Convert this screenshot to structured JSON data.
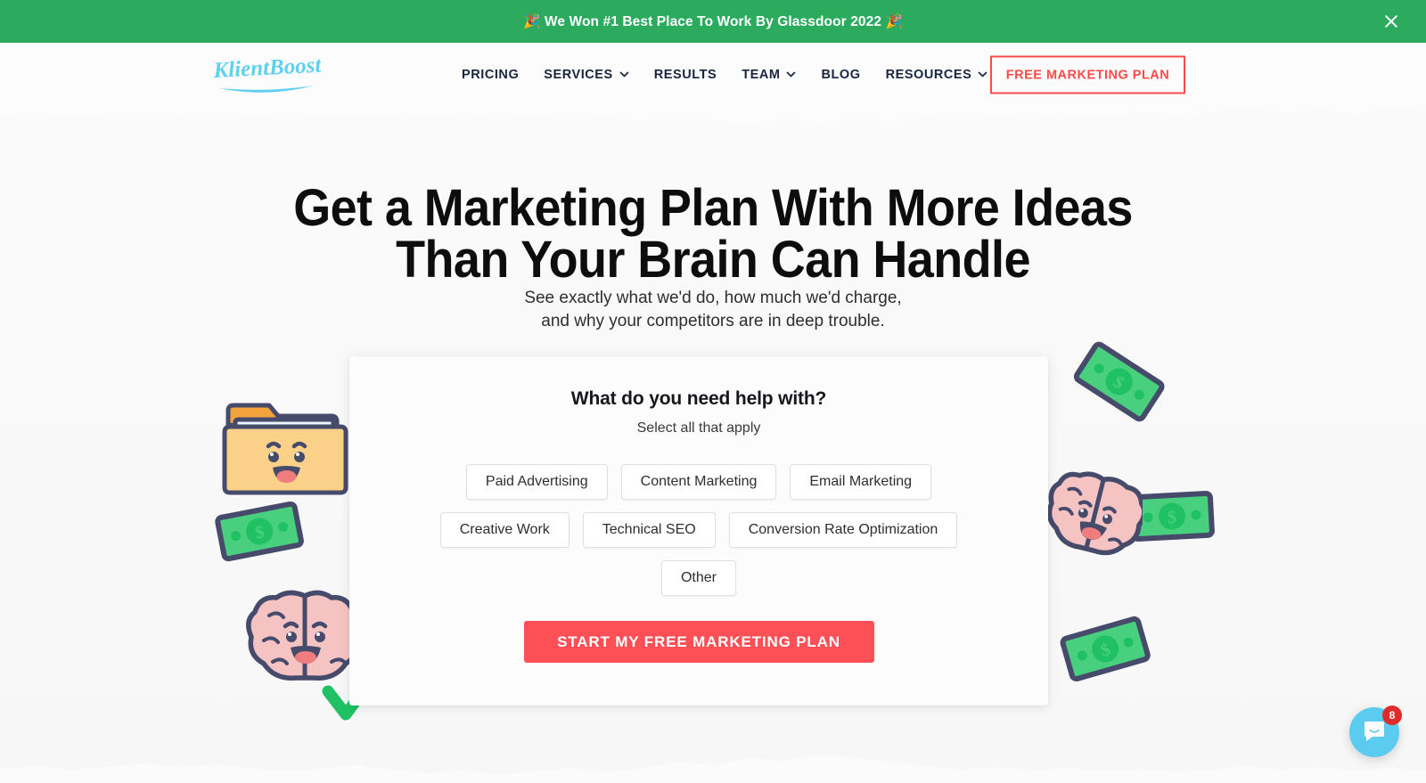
{
  "banner": {
    "text": "🎉 We Won #1 Best Place To Work By Glassdoor 2022 🎉",
    "close_label": "×",
    "background_color": "#2cab5f"
  },
  "header": {
    "logo_text": "KlientBoost",
    "nav": [
      {
        "label": "PRICING",
        "has_dropdown": false
      },
      {
        "label": "SERVICES",
        "has_dropdown": true
      },
      {
        "label": "RESULTS",
        "has_dropdown": false
      },
      {
        "label": "TEAM",
        "has_dropdown": true
      },
      {
        "label": "BLOG",
        "has_dropdown": false
      },
      {
        "label": "RESOURCES",
        "has_dropdown": true
      }
    ],
    "cta_label": "FREE MARKETING PLAN",
    "cta_color": "#fc4a4a"
  },
  "hero": {
    "title_line_1": "Get a Marketing Plan With More Ideas",
    "title_line_2": "Than Your Brain Can Handle",
    "subtitle_line_1": "See exactly what we'd do, how much we'd charge,",
    "subtitle_line_2": "and why your competitors are in deep trouble."
  },
  "form": {
    "title": "What do you need help with?",
    "subtitle": "Select all that apply",
    "options_row_1": [
      {
        "label": "Paid Advertising"
      },
      {
        "label": "Content Marketing"
      },
      {
        "label": "Email Marketing"
      }
    ],
    "options_row_2": [
      {
        "label": "Creative Work"
      },
      {
        "label": "Technical SEO"
      },
      {
        "label": "Conversion Rate Optimization"
      }
    ],
    "options_row_3": [
      {
        "label": "Other"
      }
    ],
    "submit_label": "START MY FREE MARKETING PLAN",
    "submit_color": "#fc5056"
  },
  "chat": {
    "unread_count": "8",
    "launcher_color": "#5ccbf0",
    "badge_color": "#e02b2b"
  }
}
